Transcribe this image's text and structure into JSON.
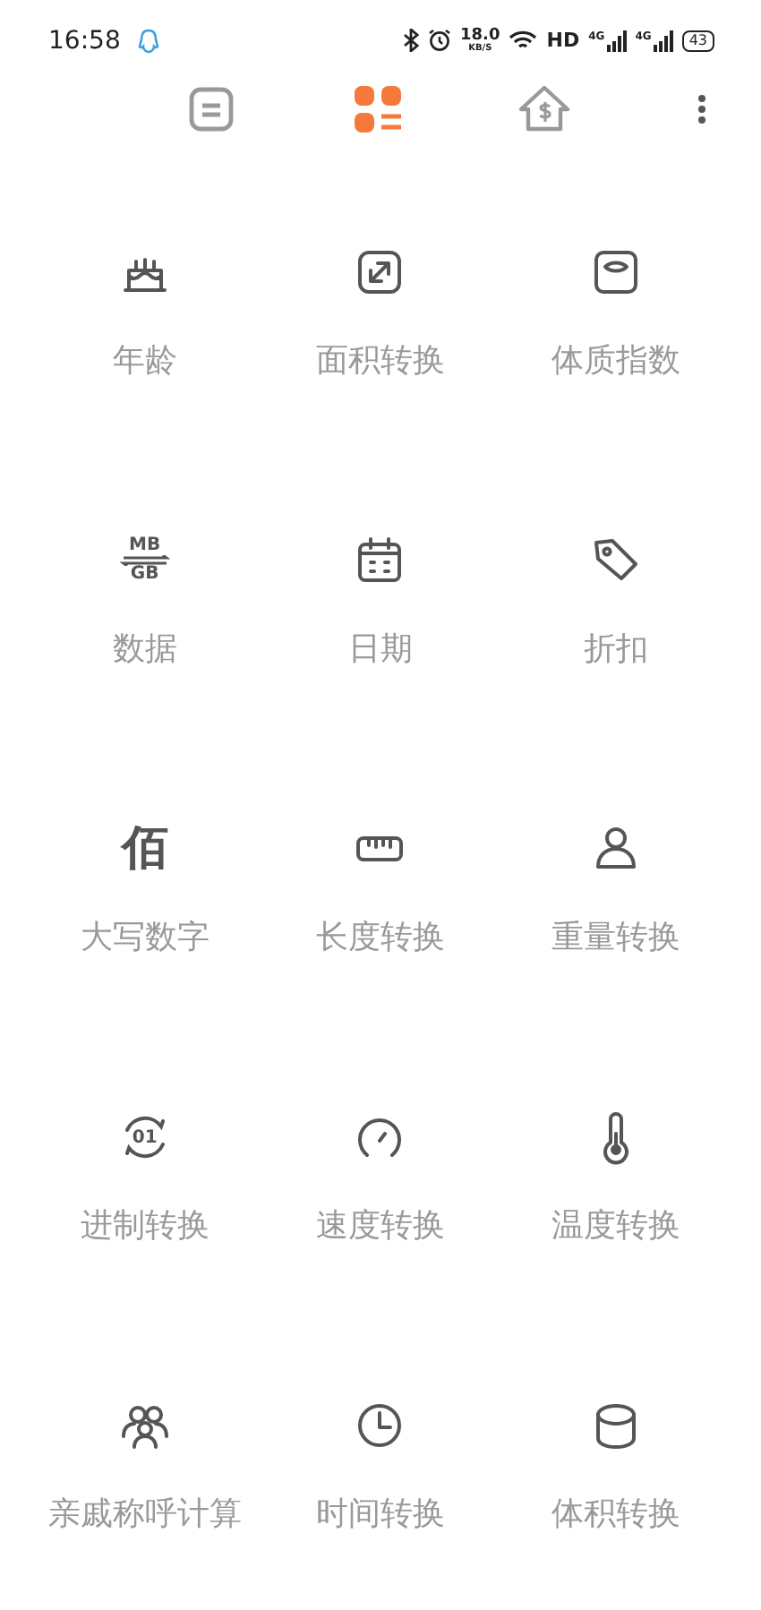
{
  "status_bar": {
    "time": "16:58",
    "speed_value": "18.0",
    "speed_unit": "KB/S",
    "hd": "HD",
    "signals": [
      {
        "label": "4G"
      },
      {
        "label": "4G"
      }
    ],
    "battery": "43"
  },
  "tabs": [
    {
      "kind": "note",
      "selected": false
    },
    {
      "kind": "grid",
      "selected": true
    },
    {
      "kind": "house",
      "selected": false
    }
  ],
  "tools": [
    {
      "kind": "cake",
      "label": "年龄"
    },
    {
      "kind": "resize",
      "label": "面积转换"
    },
    {
      "kind": "scale",
      "label": "体质指数"
    },
    {
      "kind": "data",
      "top": "MB",
      "bottom": "GB",
      "label": "数据"
    },
    {
      "kind": "calendar",
      "label": "日期"
    },
    {
      "kind": "tag",
      "label": "折扣"
    },
    {
      "kind": "glyph",
      "glyph": "佰",
      "label": "大写数字"
    },
    {
      "kind": "ruler",
      "label": "长度转换"
    },
    {
      "kind": "weight",
      "label": "重量转换"
    },
    {
      "kind": "base",
      "digits": "01",
      "label": "进制转换"
    },
    {
      "kind": "gauge",
      "label": "速度转换"
    },
    {
      "kind": "thermometer",
      "label": "温度转换"
    },
    {
      "kind": "people",
      "label": "亲戚称呼计算"
    },
    {
      "kind": "clock",
      "label": "时间转换"
    },
    {
      "kind": "cube",
      "label": "体积转换"
    }
  ]
}
